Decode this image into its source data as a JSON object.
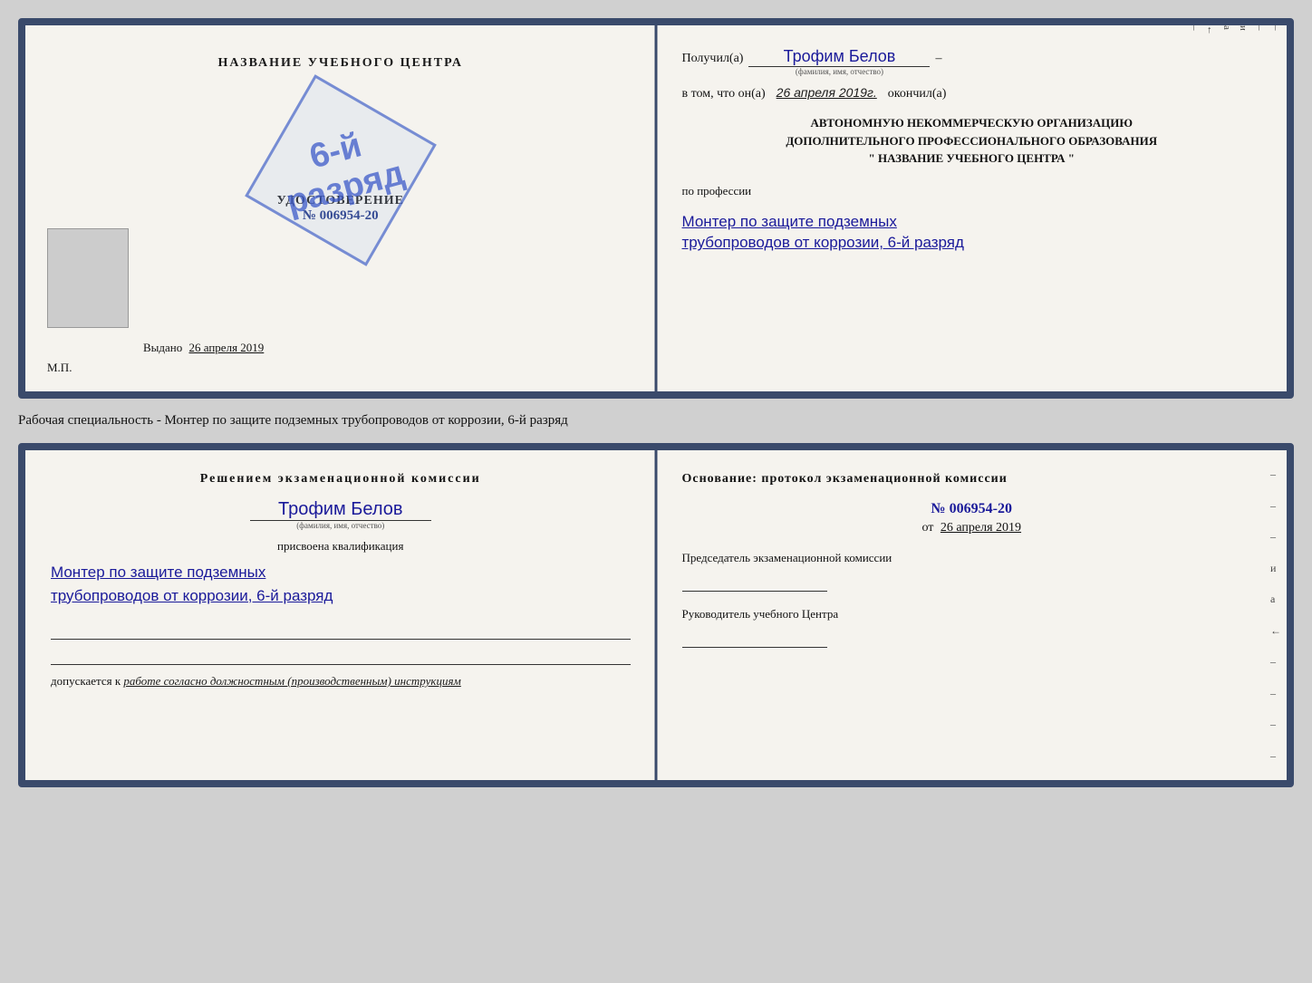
{
  "page": {
    "background_color": "#d0d0d0"
  },
  "top_cert": {
    "left": {
      "title": "НАЗВАНИЕ УЧЕБНОГО ЦЕНТРА",
      "stamp_line1": "6-й",
      "stamp_line2": "разряд",
      "udostoverenie_label": "УДОСТОВЕРЕНИЕ",
      "number_prefix": "№",
      "number": "006954-20",
      "vydano_label": "Выдано",
      "vydano_date": "26 апреля 2019",
      "mp_label": "М.П."
    },
    "right": {
      "poluchil_label": "Получил(а)",
      "name_handwritten": "Трофим Белов",
      "name_subtext": "(фамилия, имя, отчество)",
      "dash": "–",
      "vtom_label": "в том, что он(а)",
      "date_handwritten": "26 апреля 2019г.",
      "okonchil_label": "окончил(а)",
      "org_line1": "АВТОНОМНУЮ НЕКОММЕРЧЕСКУЮ ОРГАНИЗАЦИЮ",
      "org_line2": "ДОПОЛНИТЕЛЬНОГО ПРОФЕССИОНАЛЬНОГО ОБРАЗОВАНИЯ",
      "org_line3": "\"   НАЗВАНИЕ УЧЕБНОГО ЦЕНТРА   \"",
      "po_professii_label": "по профессии",
      "profession_line1": "Монтер по защите подземных",
      "profession_line2": "трубопроводов от коррозии, 6-й разряд",
      "side_texts": [
        "–",
        "–",
        "и",
        "а",
        "←",
        "–"
      ]
    }
  },
  "middle": {
    "text": "Рабочая специальность - Монтер по защите подземных трубопроводов от коррозии, 6-й разряд"
  },
  "bottom_cert": {
    "left": {
      "resheniem_title": "Решением экзаменационной комиссии",
      "name_handwritten": "Трофим Белов",
      "name_subtext": "(фамилия, имя, отчество)",
      "prisvoyena_label": "присвоена квалификация",
      "qualification_line1": "Монтер по защите подземных",
      "qualification_line2": "трубопроводов от коррозии, 6-й разряд",
      "dopuskaetsya_prefix": "допускается к",
      "dopusk_italic": "работе согласно должностным (производственным) инструкциям"
    },
    "right": {
      "osnovanie_title": "Основание: протокол экзаменационной комиссии",
      "number_prefix": "№",
      "number": "006954-20",
      "ot_prefix": "от",
      "ot_date": "26 апреля 2019",
      "predsedatel_label": "Председатель экзаменационной комиссии",
      "rukovoditel_label": "Руководитель учебного Центра",
      "side_texts": [
        "–",
        "–",
        "–",
        "и",
        "а",
        "←",
        "–",
        "–",
        "–",
        "–"
      ]
    }
  }
}
